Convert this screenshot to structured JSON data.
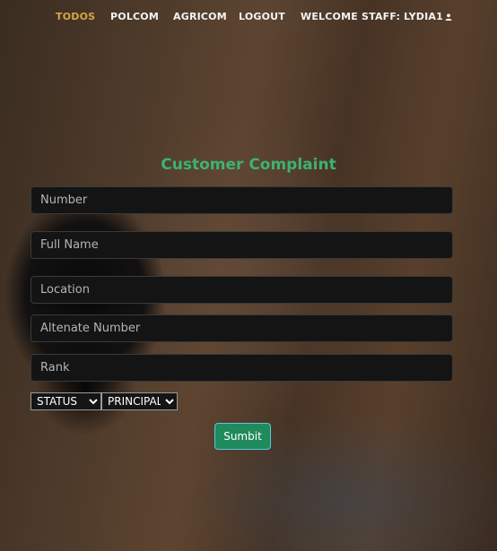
{
  "nav": {
    "items": [
      {
        "label": "TODOS",
        "active": true
      },
      {
        "label": "POLCOM",
        "active": false
      },
      {
        "label": "AGRICOM",
        "active": false
      },
      {
        "label": "LOGOUT",
        "active": false
      }
    ],
    "welcome": "WELCOME STAFF: LYDIA1",
    "welcome_icon": "user-icon"
  },
  "form": {
    "title": "Customer Complaint",
    "fields": {
      "number": {
        "placeholder": "Number",
        "value": ""
      },
      "full_name": {
        "placeholder": "Full Name",
        "value": ""
      },
      "location": {
        "placeholder": "Location",
        "value": ""
      },
      "alternate_number": {
        "placeholder": "Altenate Number",
        "value": ""
      },
      "rank": {
        "placeholder": "Rank",
        "value": ""
      }
    },
    "status_select": {
      "selected": "STATUS"
    },
    "principal_select": {
      "selected": "PRINCIPAL"
    },
    "submit_label": "Sumbit"
  },
  "colors": {
    "active_nav": "#d9a441",
    "title": "#3cb371",
    "submit_bg": "#1f8a5b",
    "submit_border": "#5fc4e4"
  }
}
